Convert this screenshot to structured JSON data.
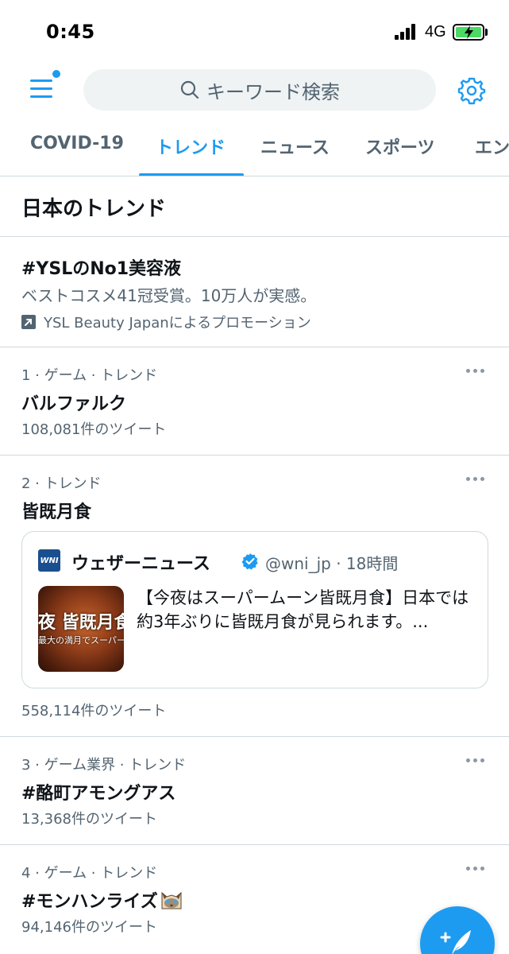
{
  "status_bar": {
    "time": "0:45",
    "network": "4G"
  },
  "header": {
    "search_placeholder": "キーワード検索"
  },
  "tabs": [
    {
      "label": "COVID-19",
      "active": false
    },
    {
      "label": "トレンド",
      "active": true
    },
    {
      "label": "ニュース",
      "active": false
    },
    {
      "label": "スポーツ",
      "active": false
    },
    {
      "label": "エン",
      "active": false
    }
  ],
  "section": {
    "title": "日本のトレンド"
  },
  "promoted": {
    "title": "#YSLのNo1美容液",
    "description": "ベストコスメ41冠受賞。10万人が実感。",
    "promoted_by": "YSL Beauty Japanによるプロモーション"
  },
  "trends": [
    {
      "meta": "1 · ゲーム · トレンド",
      "name": "バルファルク",
      "count": "108,081件のツイート"
    },
    {
      "meta": "2 · トレンド",
      "name": "皆既月食",
      "count": "558,114件のツイート",
      "tweet": {
        "logo": "WNI",
        "author": "ウェザーニュース",
        "handle": "@wni_jp · 18時間",
        "thumb_line1": "夜 皆既月食",
        "thumb_line2": "最大の満月でスーパームーン",
        "text": "【今夜はスーパームーン皆既月食】日本では約3年ぶりに皆既月食が見られます。..."
      }
    },
    {
      "meta": "3 · ゲーム業界 · トレンド",
      "name": "#酪町アモングアス",
      "count": "13,368件のツイート"
    },
    {
      "meta": "4 · ゲーム · トレンド",
      "name": "#モンハンライズ",
      "count": "94,146件のツイート"
    }
  ],
  "colors": {
    "accent": "#1d9bf0",
    "secondary_text": "#536471",
    "divider": "#cfd9de"
  }
}
